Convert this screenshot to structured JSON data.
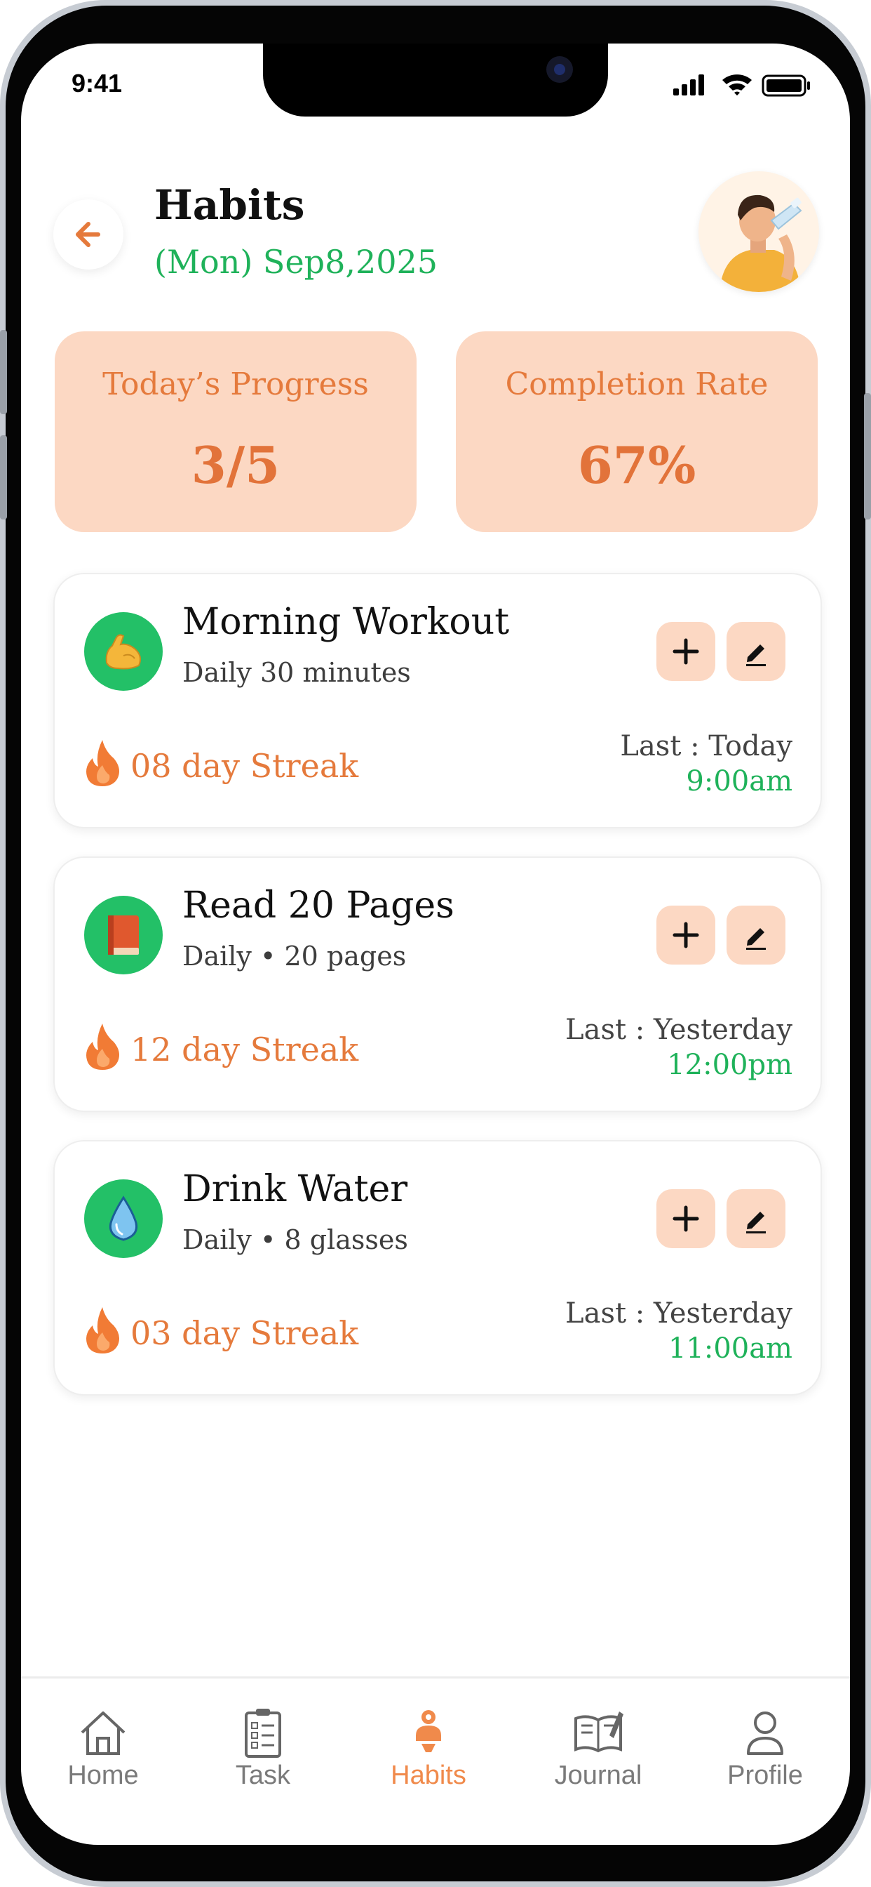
{
  "status_bar": {
    "time": "9:41"
  },
  "header": {
    "title": "Habits",
    "date": "(Mon) Sep8,2025"
  },
  "stats": {
    "progress": {
      "label": "Today’s Progress",
      "value": "3/5"
    },
    "completion": {
      "label": "Completion Rate",
      "value": "67%"
    }
  },
  "habits": [
    {
      "name": "Morning Workout",
      "detail": "Daily 30 minutes",
      "icon": "flexed-biceps-icon",
      "streak": "08 day Streak",
      "last_label": "Last : Today",
      "last_time": "9:00am"
    },
    {
      "name": "Read 20 Pages",
      "detail": "Daily • 20 pages",
      "icon": "book-icon",
      "streak": "12 day Streak",
      "last_label": "Last : Yesterday",
      "last_time": "12:00pm"
    },
    {
      "name": "Drink Water",
      "detail": "Daily • 8 glasses",
      "icon": "water-drop-icon",
      "streak": "03 day Streak",
      "last_label": "Last : Yesterday",
      "last_time": "11:00am"
    }
  ],
  "nav": [
    {
      "label": "Home",
      "icon": "home-icon",
      "active": false
    },
    {
      "label": "Task",
      "icon": "clipboard-icon",
      "active": false
    },
    {
      "label": "Habits",
      "icon": "habits-icon",
      "active": true
    },
    {
      "label": "Journal",
      "icon": "journal-icon",
      "active": false
    },
    {
      "label": "Profile",
      "icon": "person-icon",
      "active": false
    }
  ],
  "colors": {
    "accent_orange": "#e57a3c",
    "accent_green": "#1fb25a",
    "card_peach": "#fcd8c3",
    "icon_green": "#23c067"
  }
}
